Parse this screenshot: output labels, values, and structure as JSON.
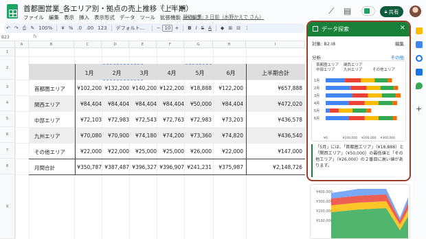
{
  "app": {
    "doc_title": "首都圏営業_各エリア別・拠点の売上推移（上半期）",
    "menu": [
      "ファイル",
      "編集",
      "表示",
      "挿入",
      "表示形式",
      "データ",
      "ツール",
      "拡張機能",
      "ヘルプ"
    ],
    "last_edit": "最終編集: 3 日前（水野かえで さん）",
    "share_label": "共有",
    "colors": {
      "sheets_green": "#188038",
      "highlight_border": "#9b3b2a",
      "link_blue": "#1a73e8"
    }
  },
  "toolbar": {
    "zoom": "100%",
    "percent": "%",
    "decimal_dec": ".0",
    "decimal_inc": ".00",
    "number_format": "123",
    "font": "デフォルト...",
    "font_size": "10",
    "bold": "B",
    "italic": "I",
    "strike": "S",
    "text_color": "A"
  },
  "formula_bar": {
    "name_box": "B23",
    "fx": "fx"
  },
  "grid": {
    "columns": [
      "A",
      "B",
      "C",
      "D",
      "E",
      "F",
      "G",
      "H",
      "I"
    ],
    "rows": [
      "1",
      "2",
      "3",
      "4",
      "5",
      "6",
      "7",
      "8",
      "9"
    ]
  },
  "table": {
    "header": [
      "",
      "1月",
      "2月",
      "3月",
      "4月",
      "5月",
      "6月",
      "上半期合計"
    ],
    "rows": [
      [
        "首都圏エリア",
        "¥102,200",
        "¥132,200",
        "¥140,200",
        "¥122,200",
        "¥18,888",
        "¥122,200",
        "¥657,888"
      ],
      [
        "関西エリア",
        "¥84,404",
        "¥84,404",
        "¥84,404",
        "¥84,404",
        "¥50,000",
        "¥84,404",
        "¥472,020"
      ],
      [
        "中部エリア",
        "¥72,103",
        "¥72,983",
        "¥72,543",
        "¥72,763",
        "¥72,983",
        "¥73,203",
        "¥436,578"
      ],
      [
        "九州エリア",
        "¥70,080",
        "¥70,900",
        "¥74,180",
        "¥74,200",
        "¥73,360",
        "¥74,820",
        "¥436,540"
      ],
      [
        "その他エリア",
        "¥22,000",
        "¥22,000",
        "¥25,000",
        "¥25,000",
        "¥26,000",
        "¥22,000",
        "¥147,000"
      ],
      [
        "月間合計",
        "¥350,787",
        "¥387,487",
        "¥396,327",
        "¥396,907",
        "¥241,231",
        "¥375,987",
        "¥2,148,726"
      ]
    ]
  },
  "explore": {
    "title": "データ探索",
    "range": "対象: B2:I8",
    "edit": "編集",
    "analysis": "分析",
    "other": "その他",
    "legend": [
      "首都圏エリア",
      "関西エリア",
      "中部エリア",
      "九州エリア",
      "その他エリア"
    ],
    "insight": "「5月」には、「首都圏エリア」（¥18,888）と「関西エリア」（¥50,000）の最低値と「その他エリア」（¥26,000）の２番目に高い値があります。",
    "lower_ticks": [
      "¥400,000",
      "¥300,000",
      "¥200,000",
      "¥100,000"
    ]
  },
  "chart_data": {
    "type": "bar",
    "orientation": "horizontal",
    "stacked": true,
    "categories": [
      "1月",
      "2月",
      "3月",
      "4月",
      "5月",
      "6月"
    ],
    "series": [
      {
        "name": "首都圏エリア",
        "values": [
          102200,
          132200,
          140200,
          122200,
          18888,
          122200
        ],
        "color": "#4285f4"
      },
      {
        "name": "関西エリア",
        "values": [
          84404,
          84404,
          84404,
          84404,
          50000,
          84404
        ],
        "color": "#ea4335"
      },
      {
        "name": "中部エリア",
        "values": [
          72103,
          72983,
          72543,
          72763,
          72983,
          73203
        ],
        "color": "#fbbc04"
      },
      {
        "name": "九州エリア",
        "values": [
          70080,
          70900,
          74180,
          74200,
          73360,
          74820
        ],
        "color": "#34a853"
      },
      {
        "name": "その他エリア",
        "values": [
          22000,
          22000,
          25000,
          25000,
          26000,
          22000
        ],
        "color": "#ff6d01"
      }
    ],
    "xticks": [
      "¥0",
      "¥100,000",
      "¥200,000",
      "¥300,000"
    ],
    "xlim": [
      0,
      400000
    ],
    "grid": true
  }
}
